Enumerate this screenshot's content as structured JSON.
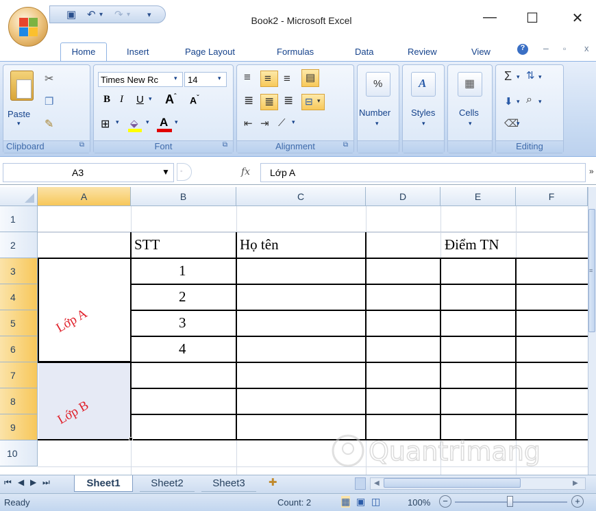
{
  "window": {
    "title": "Book2 - Microsoft Excel",
    "minimize": "—",
    "maximize": "☐",
    "close": "✕"
  },
  "ribbon": {
    "tabs": [
      "Home",
      "Insert",
      "Page Layout",
      "Formulas",
      "Data",
      "Review",
      "View"
    ],
    "clipboard": {
      "label": "Clipboard",
      "paste": "Paste"
    },
    "font": {
      "label": "Font",
      "name": "Times New Rc",
      "size": "14",
      "bold": "B",
      "italic": "I",
      "underline": "U"
    },
    "alignment": {
      "label": "Alignment"
    },
    "number": {
      "label": "Number",
      "symbol": "%"
    },
    "styles": {
      "label": "Styles"
    },
    "cells": {
      "label": "Cells"
    },
    "editing": {
      "label": "Editing",
      "sum": "Σ"
    }
  },
  "formula_bar": {
    "name_box": "A3",
    "fx": "fx",
    "formula": "Lớp A"
  },
  "grid": {
    "columns": [
      "A",
      "B",
      "C",
      "D",
      "E",
      "F"
    ],
    "rows": [
      "1",
      "2",
      "3",
      "4",
      "5",
      "6",
      "7",
      "8",
      "9",
      "10"
    ],
    "header": {
      "stt": "STT",
      "ho_ten": "Họ tên",
      "diem": "Điểm TN"
    },
    "stt_values": [
      "1",
      "2",
      "3",
      "4"
    ],
    "class_a": "Lớp A",
    "class_b": "Lớp B"
  },
  "sheets": {
    "tabs": [
      "Sheet1",
      "Sheet2",
      "Sheet3"
    ],
    "active": "Sheet1"
  },
  "status": {
    "ready": "Ready",
    "count": "Count: 2",
    "zoom": "100%"
  },
  "watermark": "Quantrimang",
  "colors": {
    "accent": "#15428b",
    "selected_header": "#f7c75a",
    "class_text": "#e0202a"
  }
}
